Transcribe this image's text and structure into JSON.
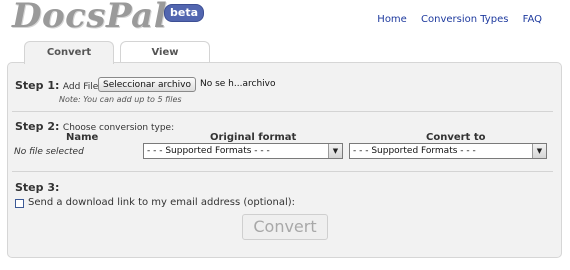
{
  "header": {
    "logo_text": "DocsPal",
    "beta_badge": "beta",
    "nav": [
      "Home",
      "Conversion Types",
      "FAQ"
    ]
  },
  "tabs": [
    {
      "label": "Convert",
      "active": true
    },
    {
      "label": "View",
      "active": false
    }
  ],
  "step1": {
    "title": "Step 1:",
    "label": "Add File:",
    "file_button": "Seleccionar archivo",
    "file_status": "No se h...archivo",
    "note": "Note: You can add up to 5 files"
  },
  "step2": {
    "title": "Step 2:",
    "label": "Choose conversion type:",
    "columns": [
      "Name",
      "Original format",
      "Convert to"
    ],
    "row": {
      "name": "No file selected",
      "original_format": "- - - Supported Formats - - -",
      "convert_to": "- - - Supported Formats - - -"
    }
  },
  "step3": {
    "title": "Step 3:",
    "email_option": "Send a download link to my email address (optional):",
    "email_checked": false
  },
  "convert_button": "Convert",
  "colors": {
    "nav_link": "#1e3a9e",
    "beta_bg": "#5266b0",
    "panel_bg": "#f2f2f2"
  }
}
